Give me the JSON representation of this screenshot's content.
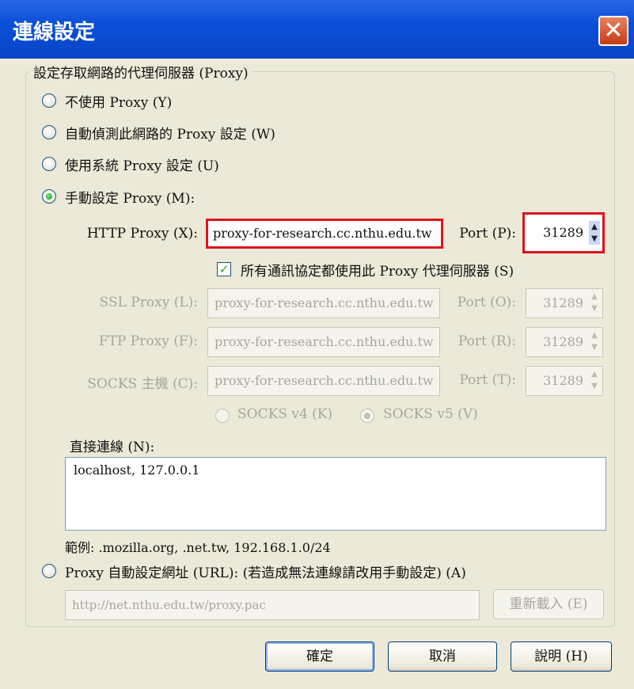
{
  "window": {
    "title": "連線設定",
    "close_glyph": "✕"
  },
  "group": {
    "title": "設定存取網路的代理伺服器 (Proxy)"
  },
  "options": {
    "no_proxy": "不使用 Proxy (Y)",
    "auto_detect": "自動偵測此網路的 Proxy 設定 (W)",
    "system_proxy": "使用系統 Proxy 設定 (U)",
    "manual": "手動設定 Proxy (M):",
    "auto_url": "Proxy 自動設定網址 (URL): (若造成無法連線請改用手動設定) (A)"
  },
  "http": {
    "label": "HTTP Proxy (X):",
    "host": "proxy-for-research.cc.nthu.edu.tw",
    "port_label": "Port (P):",
    "port": "31289"
  },
  "same_proxy": {
    "label": "所有通訊協定都使用此 Proxy 代理伺服器 (S)",
    "checked": true
  },
  "ssl": {
    "label": "SSL Proxy (L):",
    "host": "proxy-for-research.cc.nthu.edu.tw",
    "port_label": "Port (O):",
    "port": "31289"
  },
  "ftp": {
    "label": "FTP Proxy (F):",
    "host": "proxy-for-research.cc.nthu.edu.tw",
    "port_label": "Port (R):",
    "port": "31289"
  },
  "socks": {
    "label": "SOCKS 主機 (C):",
    "host": "proxy-for-research.cc.nthu.edu.tw",
    "port_label": "Port (T):",
    "port": "31289",
    "v4": "SOCKS v4 (K)",
    "v5": "SOCKS v5 (V)"
  },
  "direct": {
    "label": "直接連線 (N):",
    "value": "localhost, 127.0.0.1",
    "example": "範例: .mozilla.org, .net.tw, 192.168.1.0/24"
  },
  "pac": {
    "url": "http://net.nthu.edu.tw/proxy.pac",
    "reload": "重新載入 (E)"
  },
  "buttons": {
    "ok": "確定",
    "cancel": "取消",
    "help": "說明 (H)"
  },
  "spin": {
    "up": "▲",
    "down": "▼"
  }
}
